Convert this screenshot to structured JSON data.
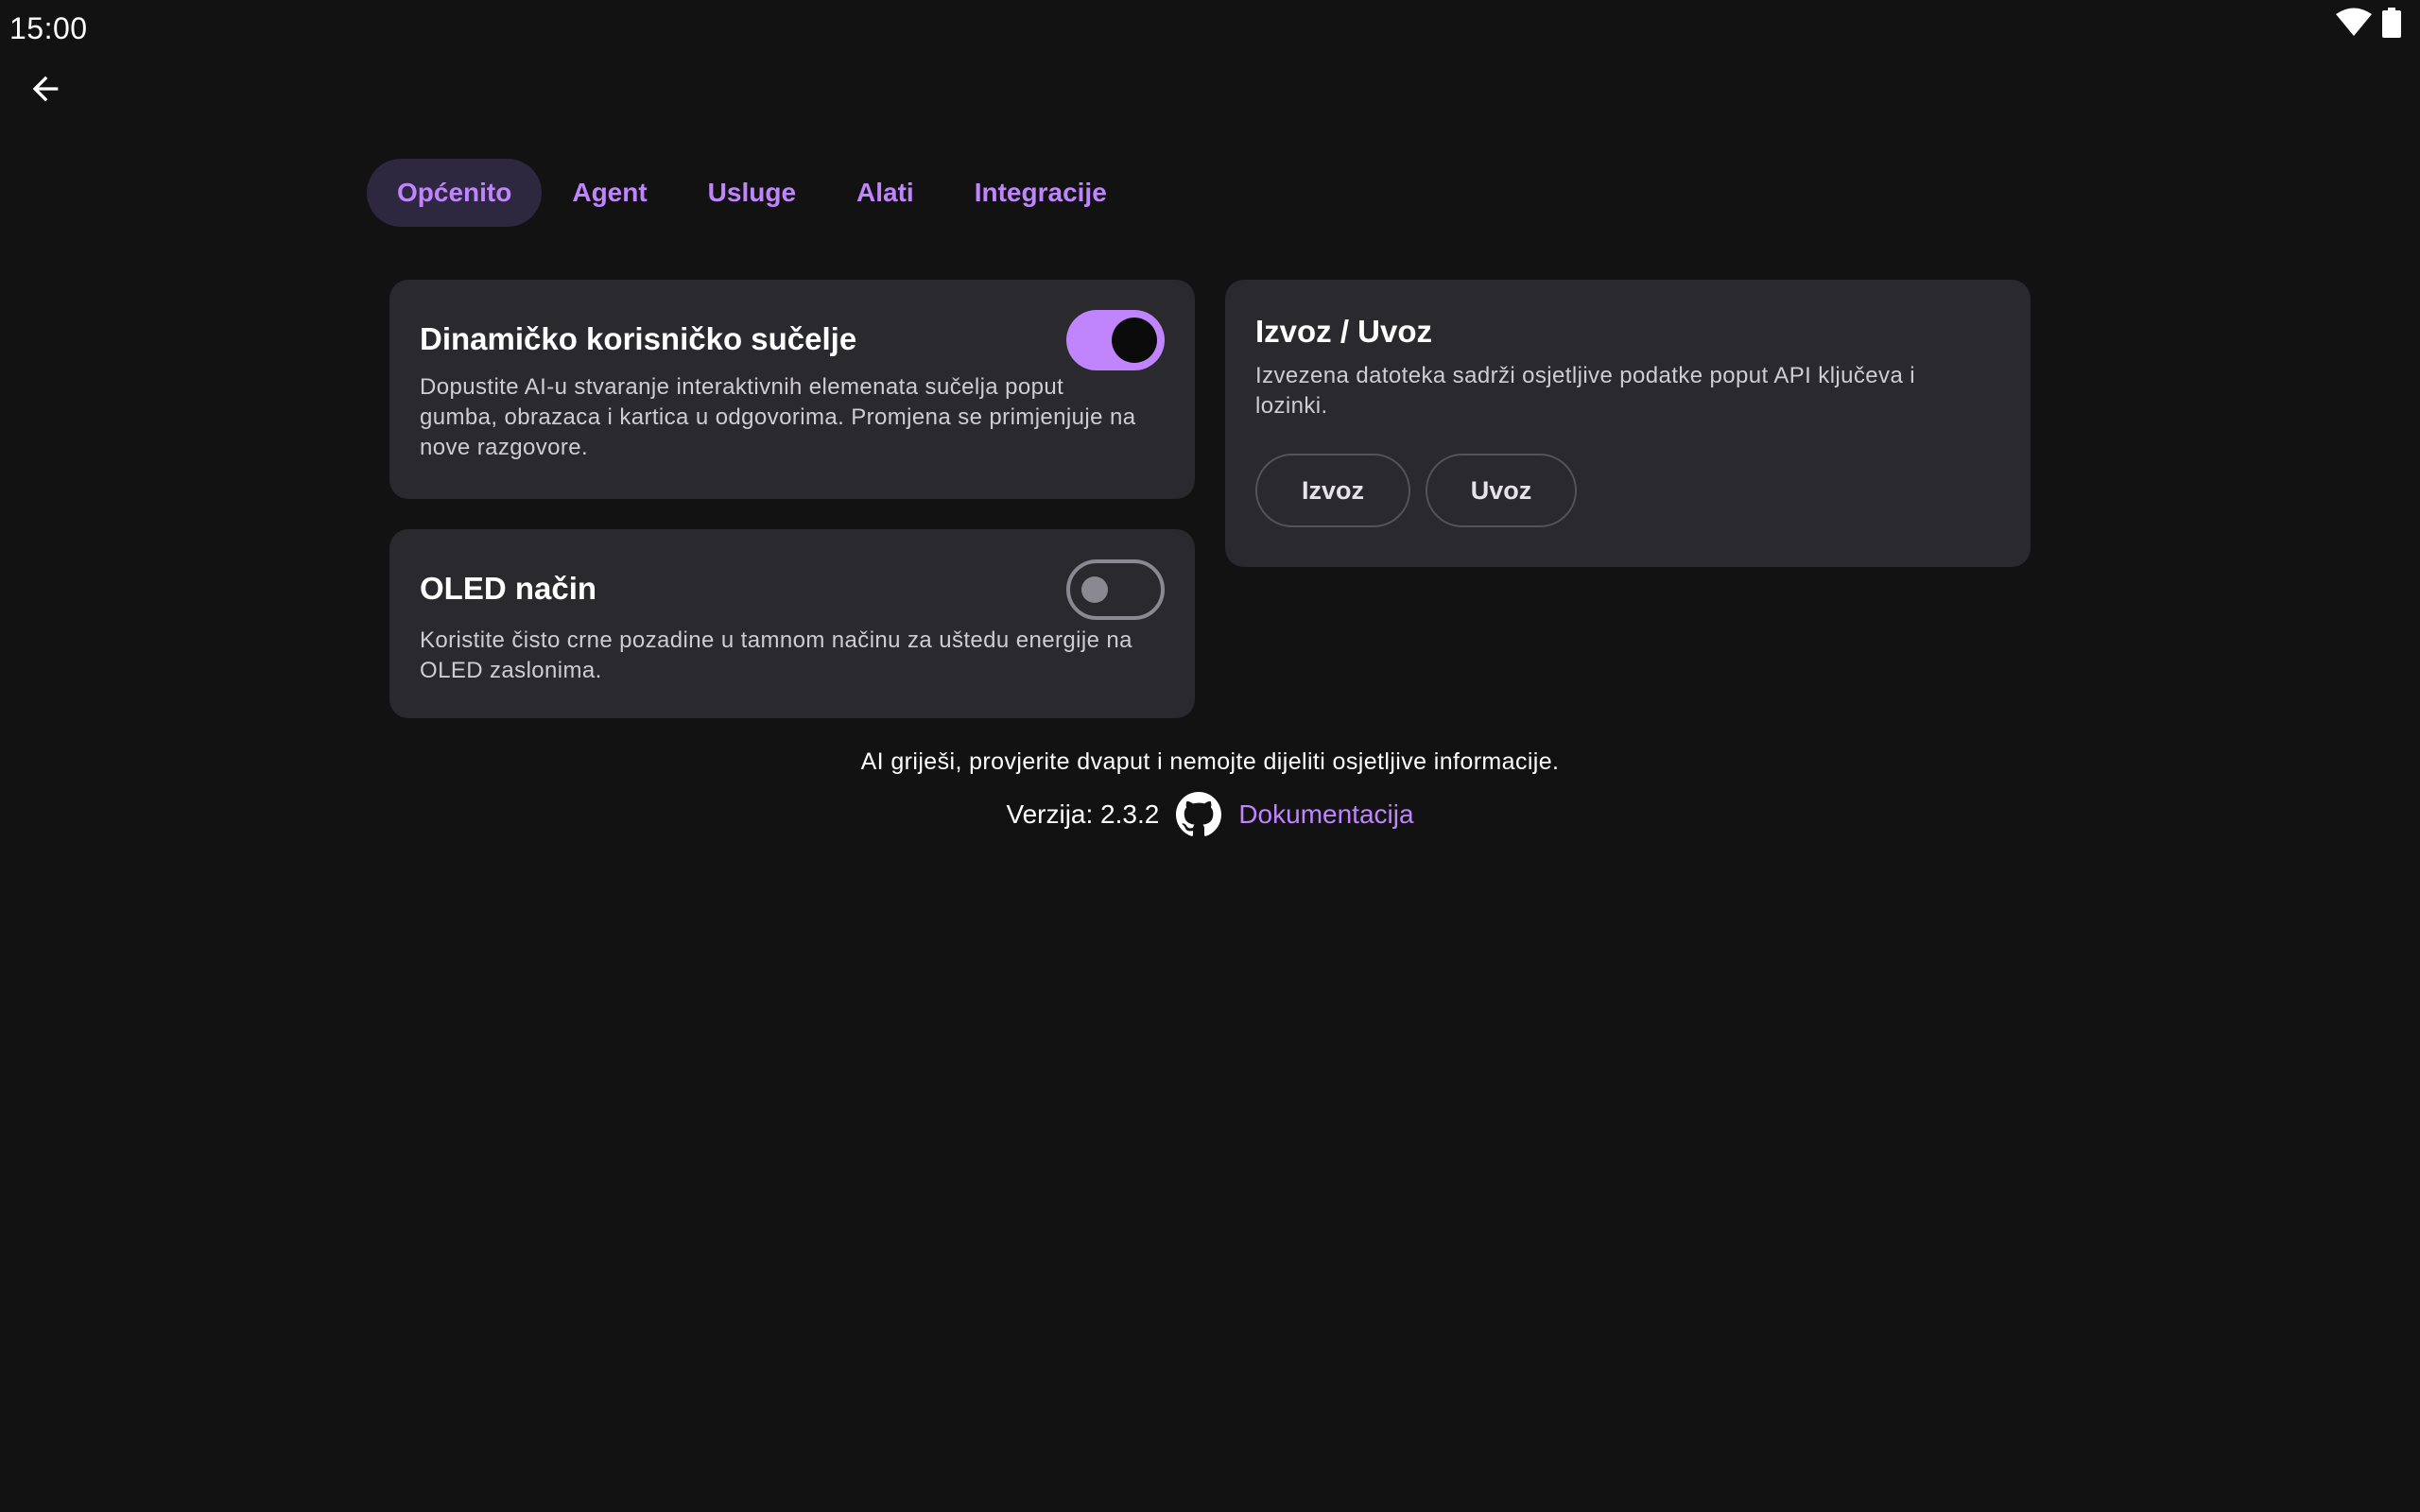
{
  "status_bar": {
    "time": "15:00",
    "icons": [
      "wifi-icon",
      "battery-icon"
    ]
  },
  "nav": {
    "back_icon": "arrow-left-icon"
  },
  "tabs": [
    {
      "label": "Općenito",
      "active": true
    },
    {
      "label": "Agent",
      "active": false
    },
    {
      "label": "Usluge",
      "active": false
    },
    {
      "label": "Alati",
      "active": false
    },
    {
      "label": "Integracije",
      "active": false
    }
  ],
  "cards": {
    "dynamic_ui": {
      "title": "Dinamičko korisničko sučelje",
      "description_lines": [
        "Dopustite AI-u stvaranje interaktivnih elemenata sučelja poput",
        "gumba, obrazaca i kartica u odgovorima. Promjena se primjenjuje na",
        "nove razgovore."
      ],
      "enabled": true
    },
    "oled": {
      "title": "OLED način",
      "description_lines": [
        "Koristite čisto crne pozadine u tamnom načinu za uštedu energije na",
        "OLED zaslonima."
      ],
      "enabled": false
    },
    "export_import": {
      "title": "Izvoz / Uvoz",
      "description_lines": [
        "Izvezena datoteka sadrži osjetljive podatke poput API ključeva i",
        "lozinki."
      ],
      "export_label": "Izvoz",
      "import_label": "Uvoz"
    }
  },
  "footer": {
    "disclaimer": "AI griješi, provjerite dvaput i nemojte dijeliti osjetljive informacije.",
    "version": "Verzija: 2.3.2",
    "github_icon": "github-icon",
    "docs_label": "Dokumentacija"
  },
  "colors": {
    "background": "#121212",
    "card": "#2a292e",
    "accent": "#c084fc",
    "active_tab_bg": "#2e2740"
  }
}
